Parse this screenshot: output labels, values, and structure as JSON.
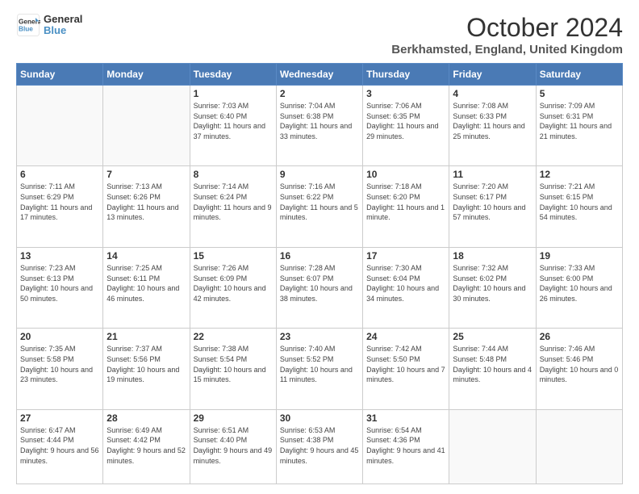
{
  "logo": {
    "line1": "General",
    "line2": "Blue"
  },
  "title": "October 2024",
  "location": "Berkhamsted, England, United Kingdom",
  "weekdays": [
    "Sunday",
    "Monday",
    "Tuesday",
    "Wednesday",
    "Thursday",
    "Friday",
    "Saturday"
  ],
  "weeks": [
    [
      {
        "day": "",
        "info": ""
      },
      {
        "day": "",
        "info": ""
      },
      {
        "day": "1",
        "info": "Sunrise: 7:03 AM\nSunset: 6:40 PM\nDaylight: 11 hours and 37 minutes."
      },
      {
        "day": "2",
        "info": "Sunrise: 7:04 AM\nSunset: 6:38 PM\nDaylight: 11 hours and 33 minutes."
      },
      {
        "day": "3",
        "info": "Sunrise: 7:06 AM\nSunset: 6:35 PM\nDaylight: 11 hours and 29 minutes."
      },
      {
        "day": "4",
        "info": "Sunrise: 7:08 AM\nSunset: 6:33 PM\nDaylight: 11 hours and 25 minutes."
      },
      {
        "day": "5",
        "info": "Sunrise: 7:09 AM\nSunset: 6:31 PM\nDaylight: 11 hours and 21 minutes."
      }
    ],
    [
      {
        "day": "6",
        "info": "Sunrise: 7:11 AM\nSunset: 6:29 PM\nDaylight: 11 hours and 17 minutes."
      },
      {
        "day": "7",
        "info": "Sunrise: 7:13 AM\nSunset: 6:26 PM\nDaylight: 11 hours and 13 minutes."
      },
      {
        "day": "8",
        "info": "Sunrise: 7:14 AM\nSunset: 6:24 PM\nDaylight: 11 hours and 9 minutes."
      },
      {
        "day": "9",
        "info": "Sunrise: 7:16 AM\nSunset: 6:22 PM\nDaylight: 11 hours and 5 minutes."
      },
      {
        "day": "10",
        "info": "Sunrise: 7:18 AM\nSunset: 6:20 PM\nDaylight: 11 hours and 1 minute."
      },
      {
        "day": "11",
        "info": "Sunrise: 7:20 AM\nSunset: 6:17 PM\nDaylight: 10 hours and 57 minutes."
      },
      {
        "day": "12",
        "info": "Sunrise: 7:21 AM\nSunset: 6:15 PM\nDaylight: 10 hours and 54 minutes."
      }
    ],
    [
      {
        "day": "13",
        "info": "Sunrise: 7:23 AM\nSunset: 6:13 PM\nDaylight: 10 hours and 50 minutes."
      },
      {
        "day": "14",
        "info": "Sunrise: 7:25 AM\nSunset: 6:11 PM\nDaylight: 10 hours and 46 minutes."
      },
      {
        "day": "15",
        "info": "Sunrise: 7:26 AM\nSunset: 6:09 PM\nDaylight: 10 hours and 42 minutes."
      },
      {
        "day": "16",
        "info": "Sunrise: 7:28 AM\nSunset: 6:07 PM\nDaylight: 10 hours and 38 minutes."
      },
      {
        "day": "17",
        "info": "Sunrise: 7:30 AM\nSunset: 6:04 PM\nDaylight: 10 hours and 34 minutes."
      },
      {
        "day": "18",
        "info": "Sunrise: 7:32 AM\nSunset: 6:02 PM\nDaylight: 10 hours and 30 minutes."
      },
      {
        "day": "19",
        "info": "Sunrise: 7:33 AM\nSunset: 6:00 PM\nDaylight: 10 hours and 26 minutes."
      }
    ],
    [
      {
        "day": "20",
        "info": "Sunrise: 7:35 AM\nSunset: 5:58 PM\nDaylight: 10 hours and 23 minutes."
      },
      {
        "day": "21",
        "info": "Sunrise: 7:37 AM\nSunset: 5:56 PM\nDaylight: 10 hours and 19 minutes."
      },
      {
        "day": "22",
        "info": "Sunrise: 7:38 AM\nSunset: 5:54 PM\nDaylight: 10 hours and 15 minutes."
      },
      {
        "day": "23",
        "info": "Sunrise: 7:40 AM\nSunset: 5:52 PM\nDaylight: 10 hours and 11 minutes."
      },
      {
        "day": "24",
        "info": "Sunrise: 7:42 AM\nSunset: 5:50 PM\nDaylight: 10 hours and 7 minutes."
      },
      {
        "day": "25",
        "info": "Sunrise: 7:44 AM\nSunset: 5:48 PM\nDaylight: 10 hours and 4 minutes."
      },
      {
        "day": "26",
        "info": "Sunrise: 7:46 AM\nSunset: 5:46 PM\nDaylight: 10 hours and 0 minutes."
      }
    ],
    [
      {
        "day": "27",
        "info": "Sunrise: 6:47 AM\nSunset: 4:44 PM\nDaylight: 9 hours and 56 minutes."
      },
      {
        "day": "28",
        "info": "Sunrise: 6:49 AM\nSunset: 4:42 PM\nDaylight: 9 hours and 52 minutes."
      },
      {
        "day": "29",
        "info": "Sunrise: 6:51 AM\nSunset: 4:40 PM\nDaylight: 9 hours and 49 minutes."
      },
      {
        "day": "30",
        "info": "Sunrise: 6:53 AM\nSunset: 4:38 PM\nDaylight: 9 hours and 45 minutes."
      },
      {
        "day": "31",
        "info": "Sunrise: 6:54 AM\nSunset: 4:36 PM\nDaylight: 9 hours and 41 minutes."
      },
      {
        "day": "",
        "info": ""
      },
      {
        "day": "",
        "info": ""
      }
    ]
  ]
}
